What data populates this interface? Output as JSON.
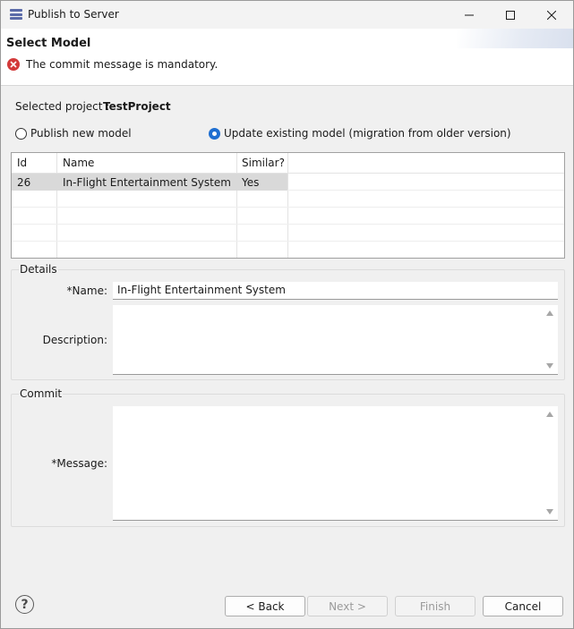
{
  "window": {
    "title": "Publish to Server"
  },
  "banner": {
    "title": "Select Model",
    "error_message": "The commit message is mandatory."
  },
  "project": {
    "label": "Selected project :",
    "value": "TestProject"
  },
  "mode": {
    "publish_new_label": "Publish new model",
    "update_existing_label": "Update existing model (migration from older version)",
    "selected": "update_existing"
  },
  "table": {
    "columns": [
      "Id",
      "Name",
      "Similar?"
    ],
    "rows": [
      {
        "id": "26",
        "name": "In-Flight Entertainment System",
        "similar": "Yes"
      }
    ]
  },
  "details": {
    "group_label": "Details",
    "name_label": "*Name:",
    "name_value": "In-Flight Entertainment System",
    "description_label": "Description:",
    "description_value": ""
  },
  "commit": {
    "group_label": "Commit",
    "message_label": "*Message:",
    "message_value": ""
  },
  "buttons": {
    "back": "< Back",
    "next": "Next >",
    "finish": "Finish",
    "cancel": "Cancel"
  },
  "icons": {
    "app": "server-publish-icon",
    "error": "error-icon",
    "help": "help-icon"
  },
  "colors": {
    "accent": "#1f6fd1",
    "error": "#d33a3a",
    "selection": "#d9d9d9"
  }
}
